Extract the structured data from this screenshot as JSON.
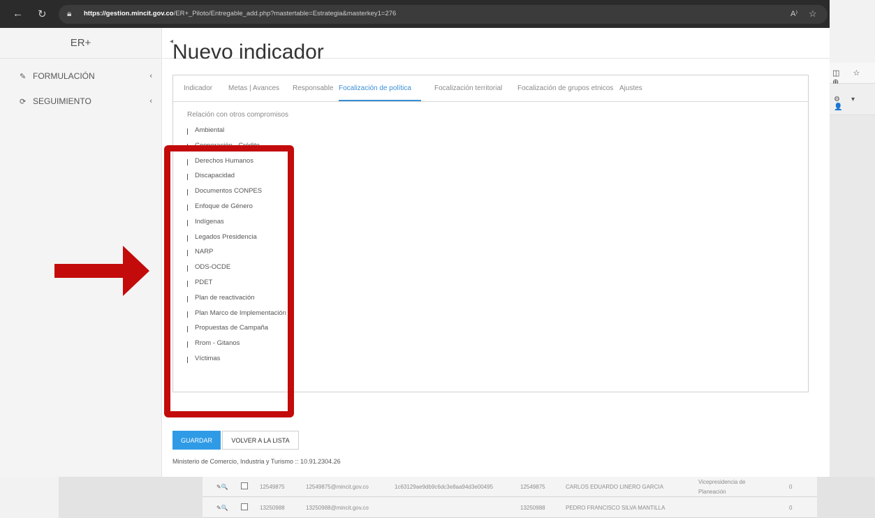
{
  "browser": {
    "url_host": "https://gestion.mincit.gov.co",
    "url_path": "/ER+_Piloto/Entregable_add.php?mastertable=Estrategia&masterkey1=276"
  },
  "sidebar": {
    "brand": "ER+",
    "items": [
      {
        "label": "FORMULACIÓN",
        "icon": "edit-icon"
      },
      {
        "label": "SEGUIMIENTO",
        "icon": "refresh-icon"
      }
    ]
  },
  "page": {
    "title": "Nuevo indicador"
  },
  "tabs": [
    {
      "label": "Indicador"
    },
    {
      "label": "Metas | Avances"
    },
    {
      "label": "Responsable"
    },
    {
      "label": "Focalización de política"
    },
    {
      "label": "Focalización territorial"
    },
    {
      "label": "Focalización de grupos etnicos"
    },
    {
      "label": "Ajustes"
    }
  ],
  "active_tab": "Focalización de política",
  "section": {
    "label": "Relación con otros compromisos",
    "items": [
      "Ambiental",
      "Cooperación - Crédito",
      "Derechos Humanos",
      "Discapacidad",
      "Documentos CONPES",
      "Enfoque de Género",
      "Indígenas",
      "Legados Presidencia",
      "NARP",
      "ODS-OCDE",
      "PDET",
      "Plan de reactivación",
      "Plan Marco de Implementación",
      "Propuestas de Campaña",
      "Rrom - Gitanos",
      "Víctimas"
    ]
  },
  "buttons": {
    "save": "GUARDAR",
    "back": "VOLVER A LA LISTA"
  },
  "footer": "Ministerio de Comercio, Industria y Turismo :: 10.91.2304.26",
  "background_rows": [
    {
      "id": "12549875",
      "email": "12549875@mincit.gov.co",
      "hash": "1c63129ae9db9c6dc3e8aa94d3e00495",
      "doc": "12549875",
      "name": "CARLOS EDUARDO LINERO GARCIA",
      "dep": "Vicepresidencia de Planeación",
      "n": "0"
    },
    {
      "id": "13250988",
      "email": "13250988@mincit.gov.co",
      "hash": "",
      "doc": "13250988",
      "name": "PEDRO FRANCISCO SILVA MANTILLA",
      "dep": "",
      "n": "0"
    }
  ],
  "colors": {
    "accent": "#3a8fd6",
    "save_button": "#2f9be6",
    "highlight": "#c30b0b"
  }
}
